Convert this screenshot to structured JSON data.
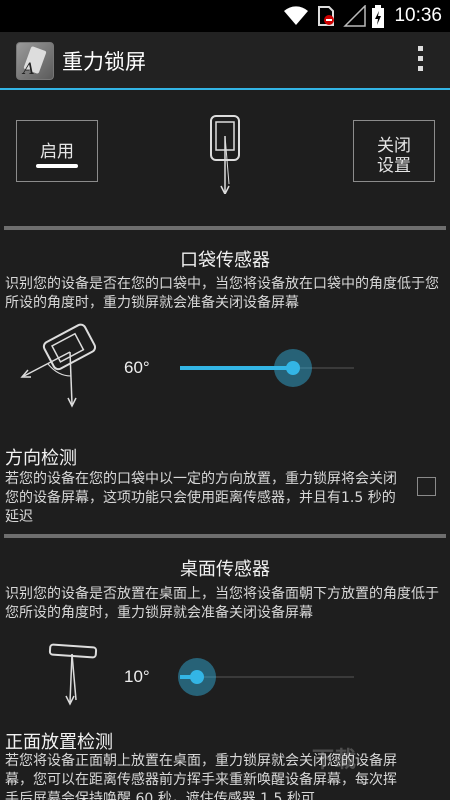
{
  "status_bar": {
    "time": "10:36",
    "icons": [
      "wifi-icon",
      "no-sim-icon",
      "signal-icon",
      "battery-charging-icon"
    ],
    "accent": "#ffffff"
  },
  "action_bar": {
    "title": "重力锁屏",
    "accent": "#33b5e5"
  },
  "toolbar": {
    "enable_label": "启用",
    "close_label_line1": "关闭",
    "close_label_line2": "设置"
  },
  "pocket": {
    "title": "口袋传感器",
    "description": "识别您的设备是否在您的口袋中，当您将设备放在口袋中的角度低于您所设的角度时，重力锁屏就会准备关闭设备屏幕",
    "angle_label": "60°",
    "slider_fraction": 0.65,
    "option_title": "方向检测",
    "option_description": "若您的设备在您的口袋中以一定的方向放置，重力锁屏将会关闭您的设备屏幕，这项功能只会使用距离传感器，并且有1.5 秒的延迟",
    "option_checked": false
  },
  "table": {
    "title": "桌面传感器",
    "description": "识别您的设备是否放置在桌面上，当您将设备面朝下方放置的角度低于您所设的角度时，重力锁屏就会准备关闭设备屏幕",
    "angle_label": "10°",
    "slider_fraction": 0.1,
    "option_title": "正面放置检测",
    "option_description": "若您将设备正面朝上放置在桌面，重力锁屏就会关闭您的设备屏幕，您可以在距离传感器前方挥手来重新唤醒设备屏幕，每次挥手后屏幕会保持唤醒 60 秒，遮住传感器 1.5 秒可"
  },
  "watermark": "下载"
}
